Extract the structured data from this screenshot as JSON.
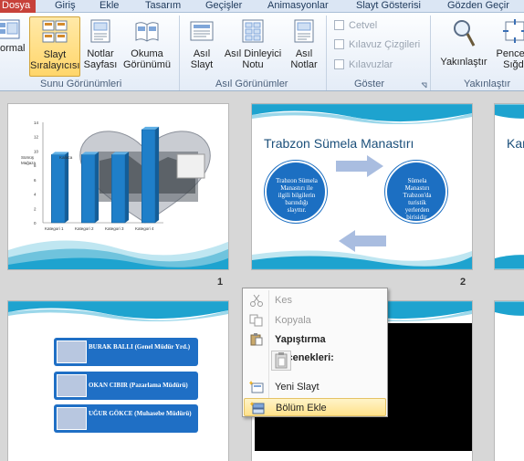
{
  "tabs": [
    "Dosya",
    "Giriş",
    "Ekle",
    "Tasarım",
    "Geçişler",
    "Animasyonlar",
    "Slayt Gösterisi",
    "Gözden Geçir"
  ],
  "ribbon": {
    "groups": {
      "sunum": "Sunu Görünümleri",
      "asil": "Asıl Görünümler",
      "goster": "Göster",
      "yakinlastir": "Yakınlaştır"
    },
    "buttons": {
      "normal": "ormal",
      "slayt_siralayici": [
        "Slayt",
        "Sıralayıcısı"
      ],
      "notlar_sayfasi": [
        "Notlar",
        "Sayfası"
      ],
      "okuma": [
        "Okuma",
        "Görünümü"
      ],
      "asil_slayt": [
        "Asıl",
        "Slayt"
      ],
      "asil_dinleyici": [
        "Asıl Dinleyici",
        "Notu"
      ],
      "asil_notlar": [
        "Asıl",
        "Notlar"
      ],
      "yakinlastir": "Yakınlaştır",
      "pencere": [
        "Pencere",
        "Sığdı"
      ]
    },
    "checkboxes": [
      "Cetvel",
      "Kılavuz Çizgileri",
      "Kılavuzlar"
    ]
  },
  "slides": {
    "s1": {
      "number": "1",
      "chart_labels": [
        "Kategori 1",
        "Kategori 2",
        "Kategori 3",
        "Kategori 4"
      ],
      "yticks": [
        "14",
        "12",
        "10",
        "8",
        "6",
        "4",
        "2",
        "0"
      ]
    },
    "s2": {
      "number": "2",
      "title": "Trabzon Sümela Manastırı",
      "left_circle": "Trabzon Sümela Manastırı ile ilgili bilgilerin barındığı slayttır.",
      "right_circle": "Sümela Manastırı Trabzon'da turistik yerlerden birisidir."
    },
    "s3_partial_title": "Kar",
    "s4": {
      "people": [
        "BURAK BALLI (Genel Müdür Yrd.)",
        "OKAN CIBIR (Pazarlama Müdürü)",
        "UĞUR GÖKCE (Muhasebe Müdürü)"
      ]
    }
  },
  "chart_data": {
    "type": "bar",
    "categories": [
      "Kategori 1",
      "Kategori 2",
      "Kategori 3",
      "Kategori 4"
    ],
    "values": [
      9.5,
      9.5,
      9.5,
      13
    ],
    "ylim": [
      0,
      14
    ]
  },
  "context_menu": {
    "kes": "Kes",
    "kopyala": "Kopyala",
    "yapistirma": "Yapıştırma Seçenekleri:",
    "yeni_slayt": "Yeni Slayt",
    "bolum_ekle": "Bölüm Ekle"
  }
}
